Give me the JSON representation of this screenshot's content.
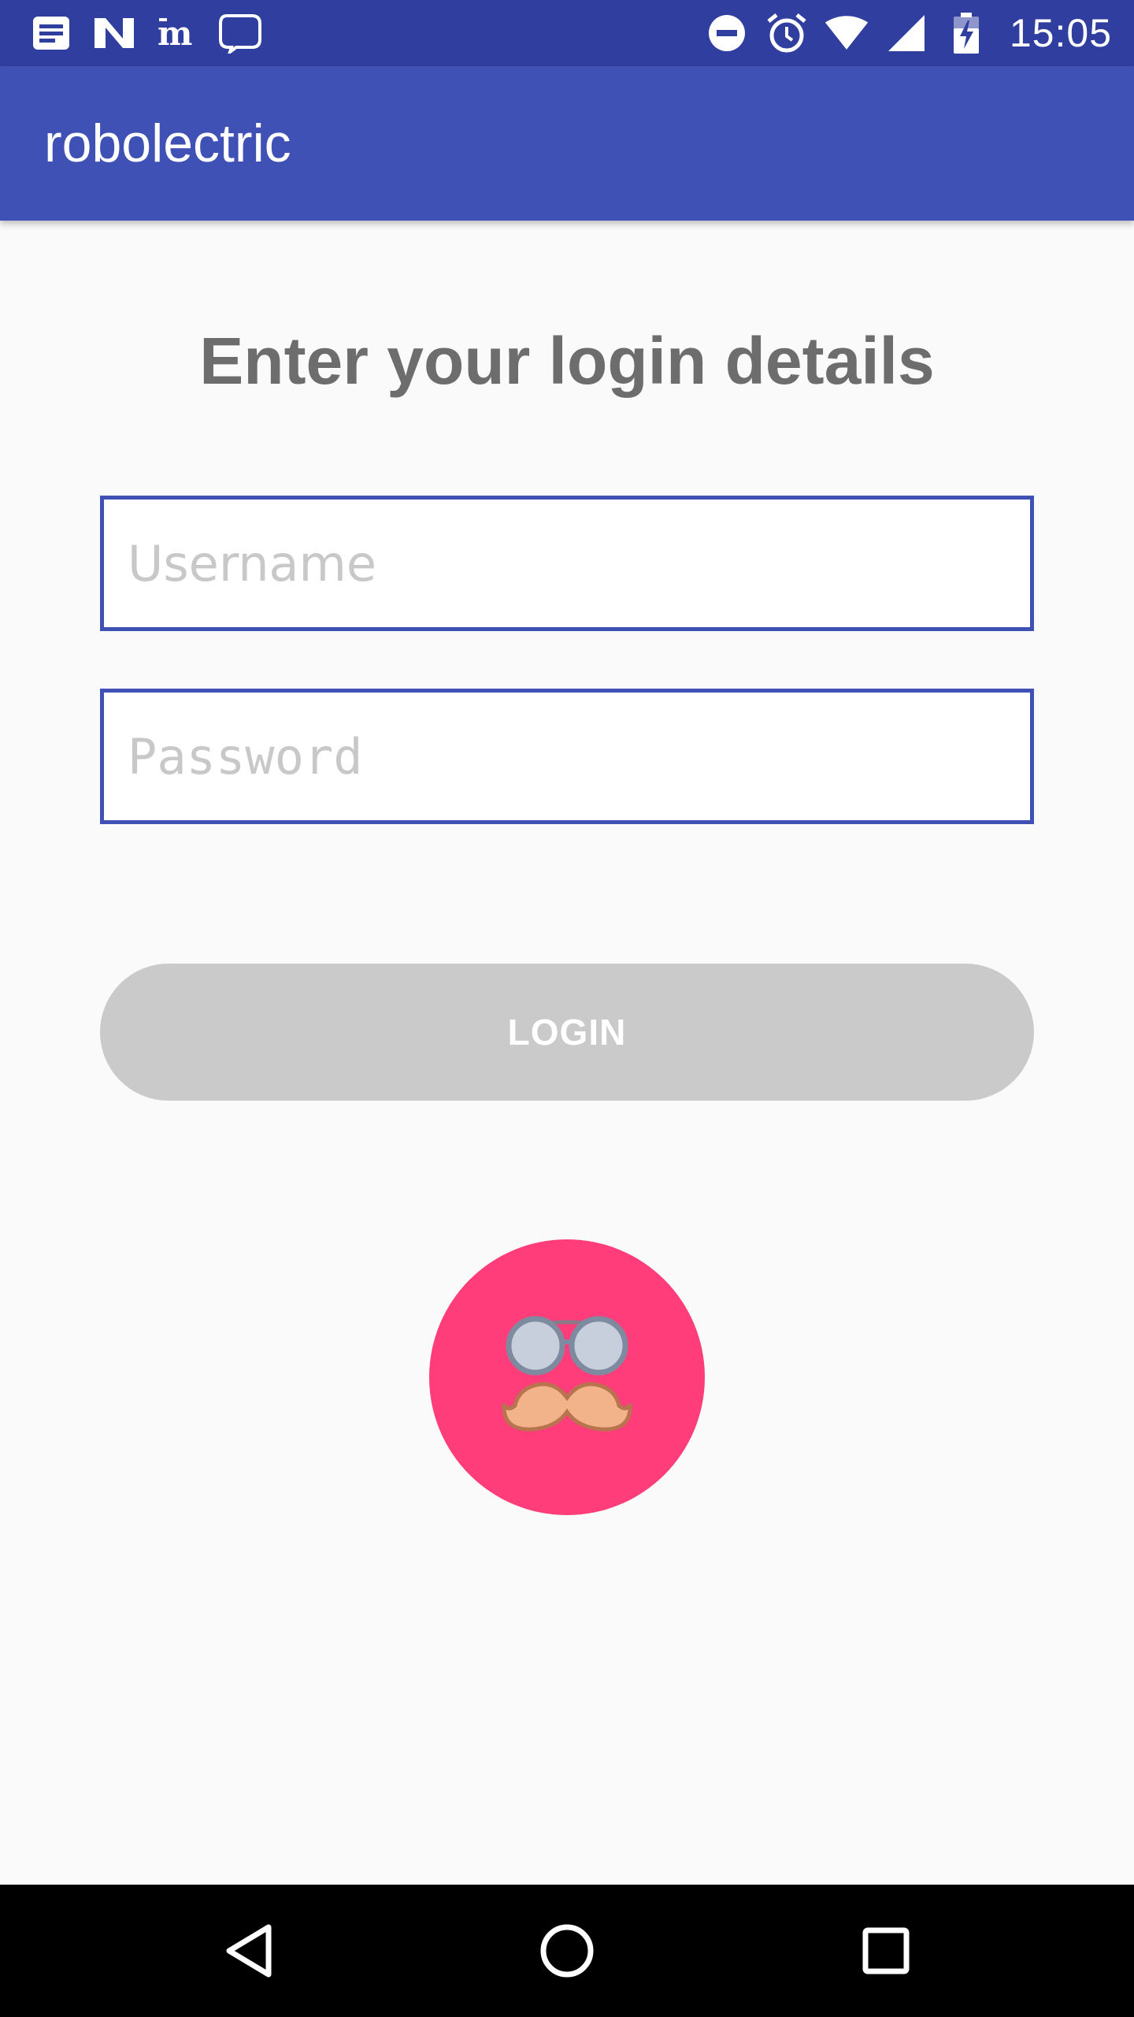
{
  "status_bar": {
    "time": "15:05",
    "left_icons": [
      "notes-icon",
      "n-app-icon",
      "nyt-icon",
      "chat-bubble-icon"
    ],
    "right_icons": [
      "do-not-disturb-icon",
      "alarm-icon",
      "wifi-icon",
      "cellular-signal-icon",
      "battery-charging-icon"
    ]
  },
  "app_bar": {
    "title": "robolectric"
  },
  "main": {
    "heading": "Enter your login details",
    "username_placeholder": "Username",
    "password_placeholder": "Password",
    "login_label": "LOGIN",
    "avatar_icon": "glasses-mustache-icon"
  },
  "nav_bar": {
    "icons": [
      "back-icon",
      "home-icon",
      "recents-icon"
    ]
  },
  "colors": {
    "status_bar": "#303f9f",
    "app_bar": "#3f51b5",
    "field_border": "#3f51b5",
    "button_disabled": "#cacaca",
    "avatar_bg": "#ff3d7a",
    "heading_text": "#6d6d6d"
  }
}
